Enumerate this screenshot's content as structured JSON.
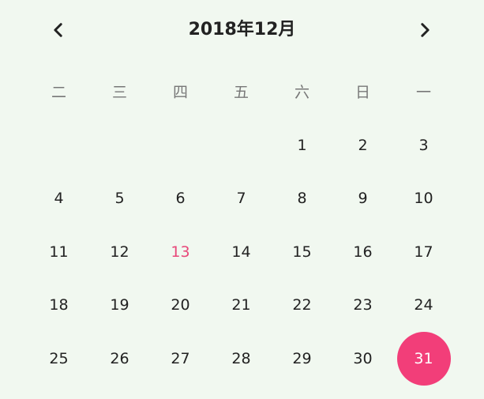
{
  "header": {
    "title": "2018年12月"
  },
  "weekdays": [
    "二",
    "三",
    "四",
    "五",
    "六",
    "日",
    "一"
  ],
  "weeks": [
    [
      "",
      "",
      "",
      "",
      "1",
      "2",
      "3"
    ],
    [
      "4",
      "5",
      "6",
      "7",
      "8",
      "9",
      "10"
    ],
    [
      "11",
      "12",
      "13",
      "14",
      "15",
      "16",
      "17"
    ],
    [
      "18",
      "19",
      "20",
      "21",
      "22",
      "23",
      "24"
    ],
    [
      "25",
      "26",
      "27",
      "28",
      "29",
      "30",
      "31"
    ]
  ],
  "today_day": "13",
  "selected_day": "31",
  "colors": {
    "background": "#f1f8f0",
    "accent": "#f23e79",
    "today_text": "#e8487a"
  },
  "icons": {
    "prev": "chevron-left-icon",
    "next": "chevron-right-icon"
  }
}
